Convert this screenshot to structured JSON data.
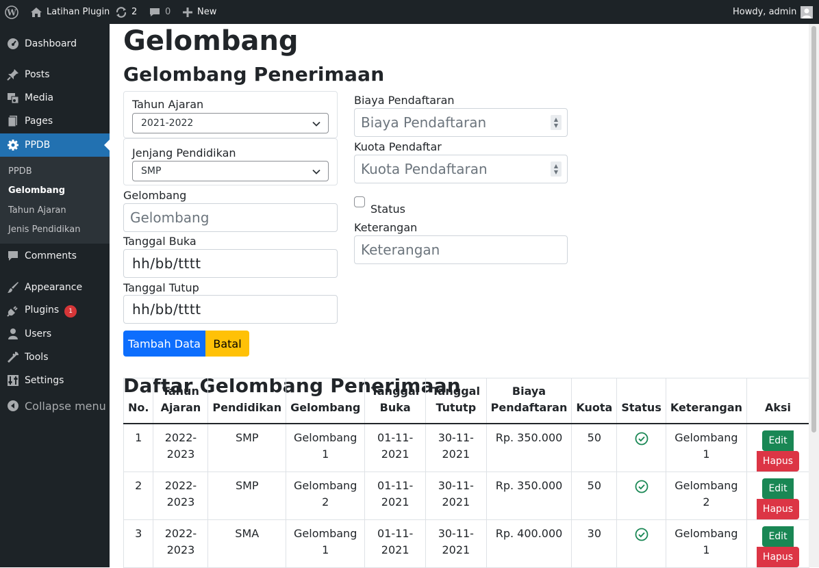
{
  "admin_bar": {
    "site_name": "Latihan Plugin",
    "updates_count": "2",
    "comments_count": "0",
    "new_label": "New",
    "greeting": "Howdy, admin"
  },
  "sidebar": {
    "items": [
      {
        "label": "Dashboard",
        "icon": "dashboard-icon"
      },
      {
        "label": "Posts",
        "icon": "pin-icon"
      },
      {
        "label": "Media",
        "icon": "media-icon"
      },
      {
        "label": "Pages",
        "icon": "pages-icon"
      },
      {
        "label": "PPDB",
        "icon": "gear-icon"
      },
      {
        "label": "Comments",
        "icon": "comment-icon"
      },
      {
        "label": "Appearance",
        "icon": "brush-icon"
      },
      {
        "label": "Plugins",
        "icon": "plugin-icon"
      },
      {
        "label": "Users",
        "icon": "user-icon"
      },
      {
        "label": "Tools",
        "icon": "wrench-icon"
      },
      {
        "label": "Settings",
        "icon": "settings-icon"
      },
      {
        "label": "Collapse menu",
        "icon": "collapse-icon"
      }
    ],
    "plugins_badge": "1",
    "submenu": [
      {
        "label": "PPDB"
      },
      {
        "label": "Gelombang"
      },
      {
        "label": "Tahun Ajaran"
      },
      {
        "label": "Jenis Pendidikan"
      }
    ]
  },
  "page": {
    "title": "Gelombang",
    "form_title": "Gelombang Penerimaan",
    "list_title": "Daftar Gelombang Penerimaan"
  },
  "form": {
    "tahun_ajaran": {
      "label": "Tahun Ajaran",
      "value": "2021-2022"
    },
    "jenjang": {
      "label": "Jenjang Pendidikan",
      "value": "SMP"
    },
    "gelombang": {
      "label": "Gelombang",
      "placeholder": "Gelombang"
    },
    "tanggal_buka": {
      "label": "Tanggal Buka",
      "placeholder": "hh/bb/tttt"
    },
    "tanggal_tutup": {
      "label": "Tanggal Tutup",
      "placeholder": "hh/bb/tttt"
    },
    "biaya": {
      "label": "Biaya Pendaftaran",
      "placeholder": "Biaya Pendaftaran"
    },
    "kuota": {
      "label": "Kuota Pendaftar",
      "placeholder": "Kuota Pendaftaran"
    },
    "status": {
      "label": "Status",
      "checked": false
    },
    "keterangan": {
      "label": "Keterangan",
      "placeholder": "Keterangan"
    },
    "submit_label": "Tambah Data",
    "cancel_label": "Batal"
  },
  "table": {
    "headers": [
      "No.",
      "Tahun Ajaran",
      "Pendidikan",
      "Gelombang",
      "Tanggal Buka",
      "Tanggal Tututp",
      "Biaya Pendaftaran",
      "Kuota",
      "Status",
      "Keterangan",
      "Aksi"
    ],
    "rows": [
      {
        "no": "1",
        "tahun": "2022-2023",
        "pendidikan": "SMP",
        "gelombang": "Gelombang 1",
        "buka": "01-11-2021",
        "tutup": "30-11-2021",
        "biaya": "Rp. 350.000",
        "kuota": "50",
        "status": "active",
        "keterangan": "Gelombang 1"
      },
      {
        "no": "2",
        "tahun": "2022-2023",
        "pendidikan": "SMP",
        "gelombang": "Gelombang 2",
        "buka": "01-11-2021",
        "tutup": "30-11-2021",
        "biaya": "Rp. 350.000",
        "kuota": "50",
        "status": "active",
        "keterangan": "Gelombang 2"
      },
      {
        "no": "3",
        "tahun": "2022-2023",
        "pendidikan": "SMA",
        "gelombang": "Gelombang 1",
        "buka": "01-11-2021",
        "tutup": "30-11-2021",
        "biaya": "Rp. 400.000",
        "kuota": "30",
        "status": "active",
        "keterangan": "Gelombang 1"
      }
    ],
    "edit_label": "Edit",
    "delete_label": "Hapus"
  },
  "colors": {
    "admin_bg": "#1d2327",
    "accent": "#2271b1",
    "primary": "#0d6efd",
    "warning": "#ffc107",
    "success": "#198754",
    "danger": "#dc3545"
  }
}
